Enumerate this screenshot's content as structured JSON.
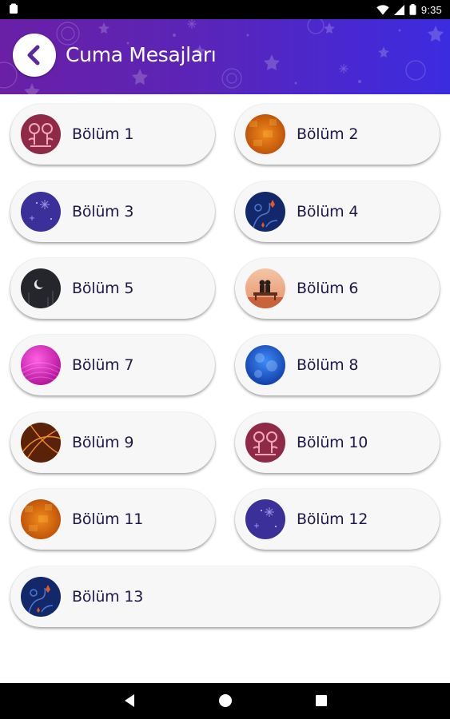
{
  "status_bar": {
    "time": "9:35",
    "icons": [
      "notification-icon",
      "wifi-icon",
      "signal-icon",
      "battery-icon"
    ]
  },
  "app_bar": {
    "title": "Cuma Mesajları",
    "back_icon": "chevron-left-icon",
    "colors": {
      "gradient_start": "#6a1fa6",
      "gradient_end": "#3c2ce0"
    }
  },
  "sections": [
    {
      "label": "Bölüm 1",
      "thumb": "pink-flowers"
    },
    {
      "label": "Bölüm 2",
      "thumb": "orange-mosaic"
    },
    {
      "label": "Bölüm 3",
      "thumb": "blue-firework"
    },
    {
      "label": "Bölüm 4",
      "thumb": "navy-vines"
    },
    {
      "label": "Bölüm 5",
      "thumb": "night-moon"
    },
    {
      "label": "Bölüm 6",
      "thumb": "couple-bench"
    },
    {
      "label": "Bölüm 7",
      "thumb": "magenta-waves"
    },
    {
      "label": "Bölüm 8",
      "thumb": "blue-bubbles"
    },
    {
      "label": "Bölüm 9",
      "thumb": "orange-swirl"
    },
    {
      "label": "Bölüm 10",
      "thumb": "pink-flowers"
    },
    {
      "label": "Bölüm 11",
      "thumb": "orange-mosaic"
    },
    {
      "label": "Bölüm 12",
      "thumb": "blue-firework"
    },
    {
      "label": "Bölüm 13",
      "thumb": "navy-vines"
    }
  ],
  "nav_bar": {
    "buttons": [
      "back-triangle-icon",
      "home-circle-icon",
      "recents-square-icon"
    ]
  }
}
